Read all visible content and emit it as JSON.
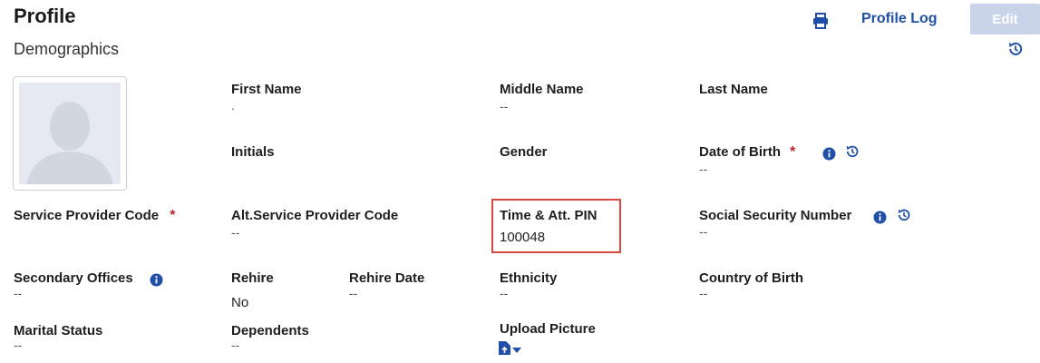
{
  "header": {
    "title": "Profile",
    "subtitle": "Demographics",
    "profile_log_label": "Profile Log",
    "edit_label": "Edit"
  },
  "fields": {
    "first_name": {
      "label": "First Name",
      "value": "."
    },
    "middle_name": {
      "label": "Middle Name",
      "value": "--"
    },
    "last_name": {
      "label": "Last Name",
      "value": ""
    },
    "initials": {
      "label": "Initials",
      "value": ""
    },
    "gender": {
      "label": "Gender",
      "value": ""
    },
    "date_of_birth": {
      "label": "Date of Birth",
      "required_mark": "*",
      "value": "--"
    },
    "service_provider_code": {
      "label": "Service Provider Code",
      "required_mark": "*",
      "value": ""
    },
    "alt_service_provider_code": {
      "label": "Alt.Service Provider Code",
      "value": "--"
    },
    "time_att_pin": {
      "label": "Time & Att. PIN",
      "value": "100048"
    },
    "ssn": {
      "label": "Social Security Number",
      "value": "--"
    },
    "secondary_offices": {
      "label": "Secondary Offices",
      "value": "--"
    },
    "rehire": {
      "label": "Rehire",
      "value": "No"
    },
    "rehire_date": {
      "label": "Rehire Date",
      "value": "--"
    },
    "ethnicity": {
      "label": "Ethnicity",
      "value": "--"
    },
    "country_of_birth": {
      "label": "Country of Birth",
      "value": "--"
    },
    "marital_status": {
      "label": "Marital Status",
      "value": "--"
    },
    "dependents": {
      "label": "Dependents",
      "value": "--"
    },
    "upload_picture": {
      "label": "Upload Picture"
    }
  },
  "colors": {
    "accent": "#1f4fa8",
    "required": "#c0252b",
    "highlight_border": "#d9473f",
    "edit_disabled": "#c9d3ea"
  }
}
